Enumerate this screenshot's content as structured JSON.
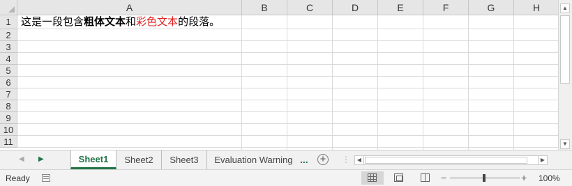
{
  "columns": [
    "A",
    "B",
    "C",
    "D",
    "E",
    "F",
    "G",
    "H"
  ],
  "rows": [
    "1",
    "2",
    "3",
    "4",
    "5",
    "6",
    "7",
    "8",
    "9",
    "10",
    "11"
  ],
  "cell_A1": {
    "part1": "这是一段包含",
    "bold": "粗体文本",
    "part2": "和",
    "red": "彩色文本",
    "part3": "的段落。"
  },
  "colors": {
    "accent": "#217346",
    "red_text": "#e02020"
  },
  "tabs": [
    "Sheet1",
    "Sheet2",
    "Sheet3",
    "Evaluation Warning"
  ],
  "active_tab": "Sheet1",
  "tab_more": "...",
  "status": {
    "text": "Ready",
    "zoom": "100%"
  },
  "icons": [
    "scroll-up-icon",
    "scroll-down-icon",
    "scroll-left-icon",
    "scroll-right-icon",
    "add-sheet-icon",
    "macro-record-icon",
    "normal-view-icon",
    "page-layout-icon",
    "page-break-icon",
    "zoom-out-icon",
    "zoom-in-icon"
  ]
}
